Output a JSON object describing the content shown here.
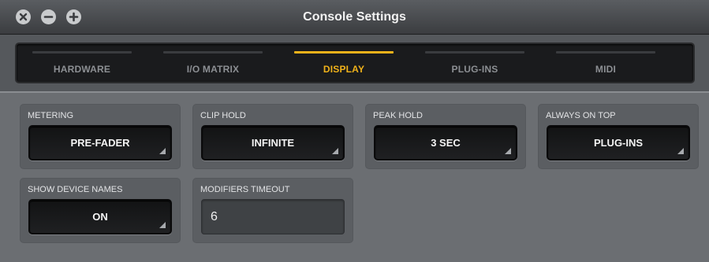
{
  "window": {
    "title": "Console Settings",
    "buttons": [
      "close-icon",
      "minimize-icon",
      "zoom-icon"
    ]
  },
  "tabs": [
    {
      "label": "HARDWARE",
      "active": false
    },
    {
      "label": "I/O MATRIX",
      "active": false
    },
    {
      "label": "DISPLAY",
      "active": true
    },
    {
      "label": "PLUG-INS",
      "active": false
    },
    {
      "label": "MIDI",
      "active": false
    }
  ],
  "settings": {
    "metering": {
      "label": "METERING",
      "value": "PRE-FADER"
    },
    "clip_hold": {
      "label": "CLIP HOLD",
      "value": "INFINITE"
    },
    "peak_hold": {
      "label": "PEAK HOLD",
      "value": "3 SEC"
    },
    "always_on_top": {
      "label": "ALWAYS ON TOP",
      "value": "PLUG-INS"
    },
    "show_device_names": {
      "label": "SHOW DEVICE NAMES",
      "value": "ON"
    },
    "modifiers_timeout": {
      "label": "MODIFIERS TIMEOUT",
      "value": "6"
    }
  },
  "colors": {
    "accent": "#f0b21a",
    "panel": "#6b6e72",
    "control": "#1a1b1d"
  }
}
